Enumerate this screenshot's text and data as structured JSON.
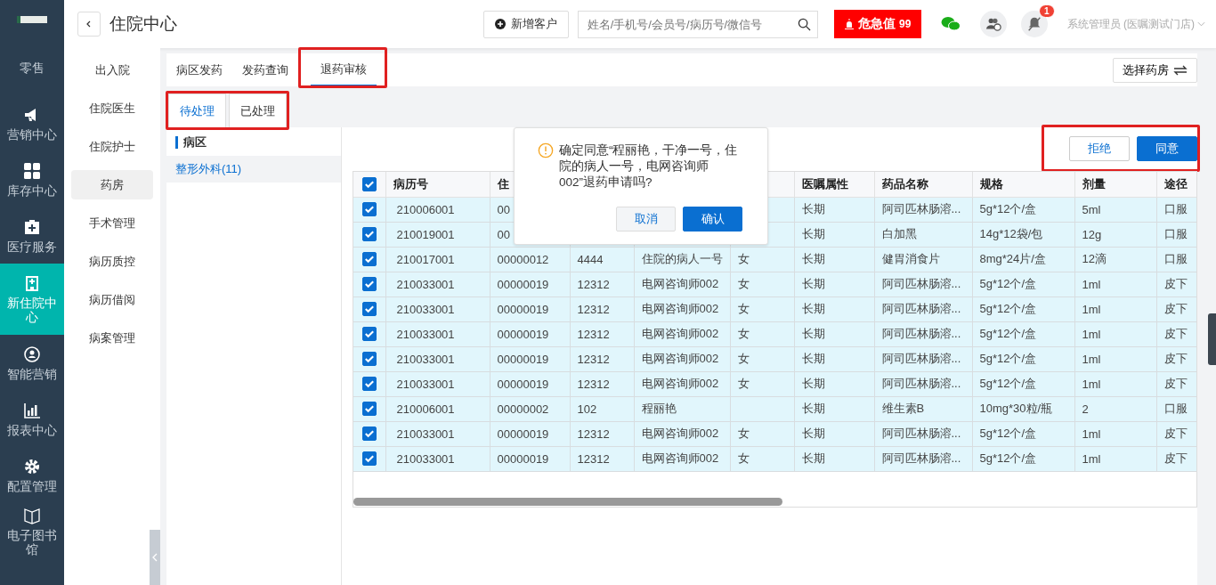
{
  "nav": {
    "items": [
      {
        "label": "零售",
        "selected": false
      },
      {
        "label": "营销中心",
        "selected": false
      },
      {
        "label": "库存中心",
        "selected": false
      },
      {
        "label": "医疗服务",
        "selected": false
      },
      {
        "label": "新住院中心",
        "selected": true
      },
      {
        "label": "智能营销",
        "selected": false
      },
      {
        "label": "报表中心",
        "selected": false
      },
      {
        "label": "配置管理",
        "selected": false
      },
      {
        "label": "电子图书馆",
        "selected": false
      }
    ]
  },
  "header": {
    "title": "住院中心",
    "new_customer": "新增客户",
    "search": {
      "placeholder": "姓名/手机号/会员号/病历号/微信号"
    },
    "alert": {
      "label": "危急值",
      "count": "99"
    },
    "notification_badge": "1",
    "user": "系统管理员 (医嘱测试门店)"
  },
  "subnav": {
    "items": [
      {
        "label": "出入院",
        "selected": false
      },
      {
        "label": "住院医生",
        "selected": false
      },
      {
        "label": "住院护士",
        "selected": false
      },
      {
        "label": "药房",
        "selected": true
      },
      {
        "label": "手术管理",
        "selected": false
      },
      {
        "label": "病历质控",
        "selected": false
      },
      {
        "label": "病历借阅",
        "selected": false
      },
      {
        "label": "病案管理",
        "selected": false
      }
    ]
  },
  "tabs": {
    "highlighted": true,
    "items": [
      {
        "label": "病区发药",
        "selected": false
      },
      {
        "label": "发药查询",
        "selected": false
      },
      {
        "label": "退药审核",
        "selected": true
      }
    ]
  },
  "pharmacy_button": "选择药房",
  "status_tabs": {
    "highlighted": true,
    "items": [
      {
        "label": "待处理",
        "selected": true
      },
      {
        "label": "已处理",
        "selected": false
      }
    ]
  },
  "wards": {
    "title": "病区",
    "items": [
      {
        "label": "整形外科(11)",
        "selected": true
      }
    ]
  },
  "actions": {
    "highlighted": true,
    "reject": "拒绝",
    "approve": "同意"
  },
  "table": {
    "all_checked": true,
    "columns": [
      "病历号",
      "住",
      "",
      "",
      "",
      "医嘱属性",
      "药品名称",
      "规格",
      "剂量",
      "途径"
    ],
    "rows": [
      {
        "checked": true,
        "cells": [
          "210006001",
          "00",
          "",
          "",
          "",
          "长期",
          "阿司匹林肠溶...",
          "5g*12个/盒",
          "5ml",
          "口服"
        ]
      },
      {
        "checked": true,
        "cells": [
          "210019001",
          "00",
          "",
          "",
          "",
          "长期",
          "白加黑",
          "14g*12袋/包",
          "12g",
          "口服"
        ]
      },
      {
        "checked": true,
        "cells": [
          "210017001",
          "00000012",
          "4444",
          "住院的病人一号",
          "女",
          "长期",
          "健胃消食片",
          "8mg*24片/盒",
          "12滴",
          "口服"
        ]
      },
      {
        "checked": true,
        "cells": [
          "210033001",
          "00000019",
          "12312",
          "电网咨询师002",
          "女",
          "长期",
          "阿司匹林肠溶...",
          "5g*12个/盒",
          "1ml",
          "皮下"
        ]
      },
      {
        "checked": true,
        "cells": [
          "210033001",
          "00000019",
          "12312",
          "电网咨询师002",
          "女",
          "长期",
          "阿司匹林肠溶...",
          "5g*12个/盒",
          "1ml",
          "皮下"
        ]
      },
      {
        "checked": true,
        "cells": [
          "210033001",
          "00000019",
          "12312",
          "电网咨询师002",
          "女",
          "长期",
          "阿司匹林肠溶...",
          "5g*12个/盒",
          "1ml",
          "皮下"
        ]
      },
      {
        "checked": true,
        "cells": [
          "210033001",
          "00000019",
          "12312",
          "电网咨询师002",
          "女",
          "长期",
          "阿司匹林肠溶...",
          "5g*12个/盒",
          "1ml",
          "皮下"
        ]
      },
      {
        "checked": true,
        "cells": [
          "210033001",
          "00000019",
          "12312",
          "电网咨询师002",
          "女",
          "长期",
          "阿司匹林肠溶...",
          "5g*12个/盒",
          "1ml",
          "皮下"
        ]
      },
      {
        "checked": true,
        "cells": [
          "210006001",
          "00000002",
          "102",
          "程丽艳",
          "",
          "长期",
          "维生素B",
          "10mg*30粒/瓶",
          "2",
          "口服"
        ]
      },
      {
        "checked": true,
        "cells": [
          "210033001",
          "00000019",
          "12312",
          "电网咨询师002",
          "女",
          "长期",
          "阿司匹林肠溶...",
          "5g*12个/盒",
          "1ml",
          "皮下"
        ]
      },
      {
        "checked": true,
        "cells": [
          "210033001",
          "00000019",
          "12312",
          "电网咨询师002",
          "女",
          "长期",
          "阿司匹林肠溶...",
          "5g*12个/盒",
          "1ml",
          "皮下"
        ]
      }
    ]
  },
  "dialog": {
    "message": "确定同意“程丽艳，干净一号，住院的病人一号，电网咨询师002”退药申请吗?",
    "cancel": "取消",
    "confirm": "确认"
  }
}
